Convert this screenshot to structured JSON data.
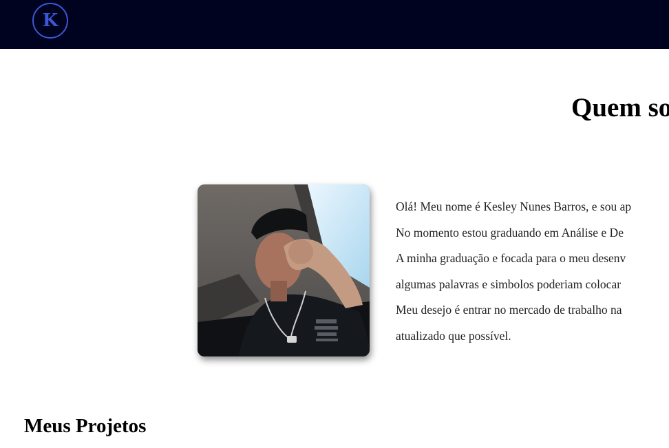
{
  "header": {
    "logo_letter": "K",
    "background_color": "#00031f",
    "logo_color": "#3d56d6"
  },
  "about": {
    "title": "Quem so",
    "photo_alt": "profile-photo",
    "paragraph_lines": [
      "Olá! Meu nome é Kesley Nunes Barros, e sou ap",
      "No momento estou graduando em Análise e De",
      "A minha graduação e focada para o meu desenv",
      "algumas palavras e simbolos poderiam colocar",
      "Meu desejo é entrar no mercado de trabalho na",
      "atualizado que possível."
    ]
  },
  "projects": {
    "title": "Meus Projetos"
  }
}
